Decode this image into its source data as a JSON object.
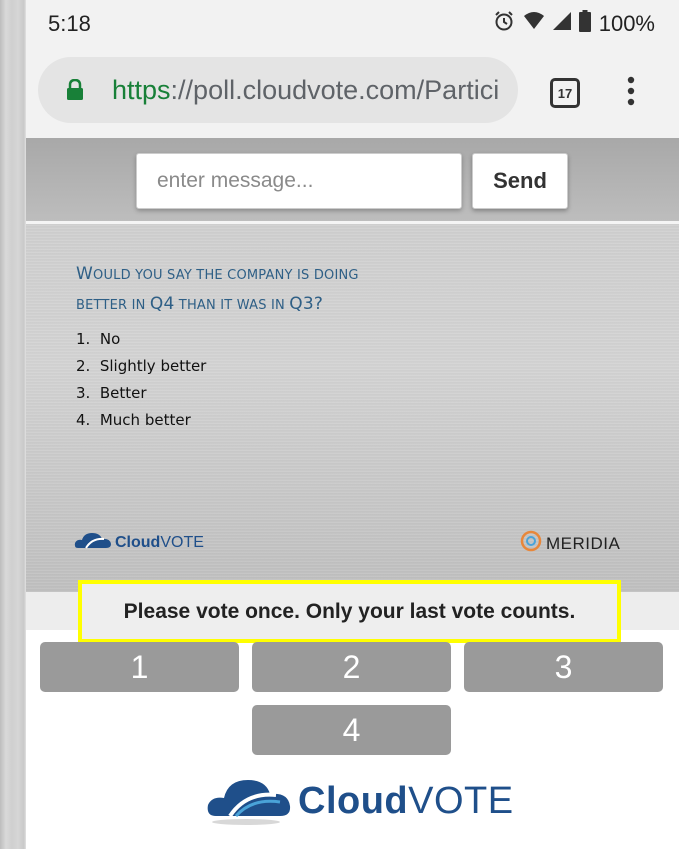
{
  "status_bar": {
    "time": "5:18",
    "battery": "100%",
    "icons": [
      "alarm-icon",
      "wifi-icon",
      "signal-icon",
      "battery-icon"
    ]
  },
  "browser": {
    "url_scheme": "https",
    "url_rest": "://poll.cloudvote.com/Partici",
    "tab_count": "17"
  },
  "message": {
    "placeholder": "enter message...",
    "send_label": "Send"
  },
  "slide": {
    "question_line1": "Would you say the company is doing",
    "question_line2_pre": "better in ",
    "question_q4": "Q4",
    "question_line2_mid": " than it was in ",
    "question_q3": "Q3",
    "question_line2_end": "?",
    "options": [
      {
        "num": "1.",
        "label": "No"
      },
      {
        "num": "2.",
        "label": "Slightly better"
      },
      {
        "num": "3.",
        "label": "Better"
      },
      {
        "num": "4.",
        "label": "Much better"
      }
    ],
    "logo_left_bold": "Cloud",
    "logo_left_light": "VOTE",
    "logo_right": "MERIDIA"
  },
  "notice": "Please vote once. Only your last vote counts.",
  "vote_buttons": [
    "1",
    "2",
    "3",
    "4"
  ],
  "footer": {
    "brand_bold": "Cloud",
    "brand_light": "VOTE"
  },
  "colors": {
    "accent_blue": "#1f4f8a",
    "question_blue": "#2e5f86",
    "highlight": "#ffff00",
    "vote_button": "#9a9a9a",
    "lock_green": "#188038"
  }
}
